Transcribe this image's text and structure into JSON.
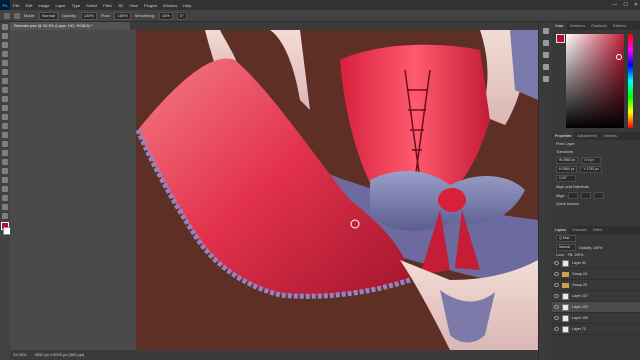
{
  "app": {
    "logo": "Ps"
  },
  "menu": [
    "File",
    "Edit",
    "Image",
    "Layer",
    "Type",
    "Select",
    "Filter",
    "3D",
    "View",
    "Plugins",
    "Window",
    "Help"
  ],
  "window_controls": [
    "—",
    "☐",
    "✕"
  ],
  "options": {
    "mode_label": "Mode:",
    "mode_value": "Normal",
    "opacity_label": "Opacity:",
    "opacity_value": "100%",
    "flow_label": "Flow:",
    "flow_value": "100%",
    "smoothing_label": "Smoothing:",
    "smoothing_value": "10%",
    "angle_value": "0°"
  },
  "document": {
    "tab_title": "Remake.psd @ 33.3% (Layer 192, RGB/8) *"
  },
  "status": {
    "zoom": "33.33%",
    "info": "4000 px x 5000 px (300 ppi)"
  },
  "color_panel": {
    "tabs": [
      "Color",
      "Swatches",
      "Gradients",
      "Patterns"
    ],
    "fg_color": "#b0102a",
    "bg_color": "#ffffff",
    "hue_color": "#c4203a"
  },
  "properties": {
    "tabs": [
      "Properties",
      "Adjustments",
      "Libraries"
    ],
    "kind": "Pixel Layer",
    "transform_label": "Transform",
    "w": "W 3960 px",
    "h": "H 3960 px",
    "x": "X 0 px",
    "y": "Y 1792 px",
    "angle": "0,00°",
    "align_label": "Align and Distribute",
    "align_sub": "Align:",
    "quick_actions": "Quick Actions"
  },
  "layers": {
    "tabs": [
      "Layers",
      "Channels",
      "Paths"
    ],
    "kind_label": "Q Kind",
    "blend": "Normal",
    "opacity": "Opacity: 100%",
    "lock": "Lock:",
    "fill": "Fill: 100%",
    "items": [
      {
        "name": "Layer 31",
        "type": "thumb"
      },
      {
        "name": "Group 24",
        "type": "folder"
      },
      {
        "name": "Group 25",
        "type": "folder"
      },
      {
        "name": "Layer 107",
        "type": "thumb"
      },
      {
        "name": "Layer 192",
        "type": "thumb",
        "selected": true
      },
      {
        "name": "Layer 190",
        "type": "thumb"
      },
      {
        "name": "Layer 72",
        "type": "thumb"
      }
    ]
  }
}
